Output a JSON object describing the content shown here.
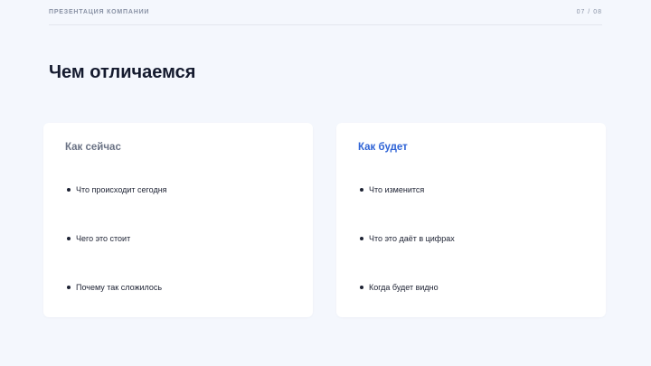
{
  "header": {
    "company_label": "ПРЕЗЕНТАЦИЯ КОМПАНИИ",
    "page_counter": "07 / 08"
  },
  "slide": {
    "title": "Чем отличаемся"
  },
  "cards": [
    {
      "heading": "Как сейчас",
      "items": [
        "Что происходит сегодня",
        "Чего это стоит",
        "Почему так сложилось"
      ]
    },
    {
      "heading": "Как будет",
      "items": [
        "Что изменится",
        "Что это даёт в цифрах",
        "Когда будет видно"
      ]
    }
  ],
  "colors": {
    "background": "#f4f7fd",
    "card_background": "#ffffff",
    "accent": "#2e63d6",
    "muted_heading": "#6b7385",
    "text": "#1d2233"
  }
}
